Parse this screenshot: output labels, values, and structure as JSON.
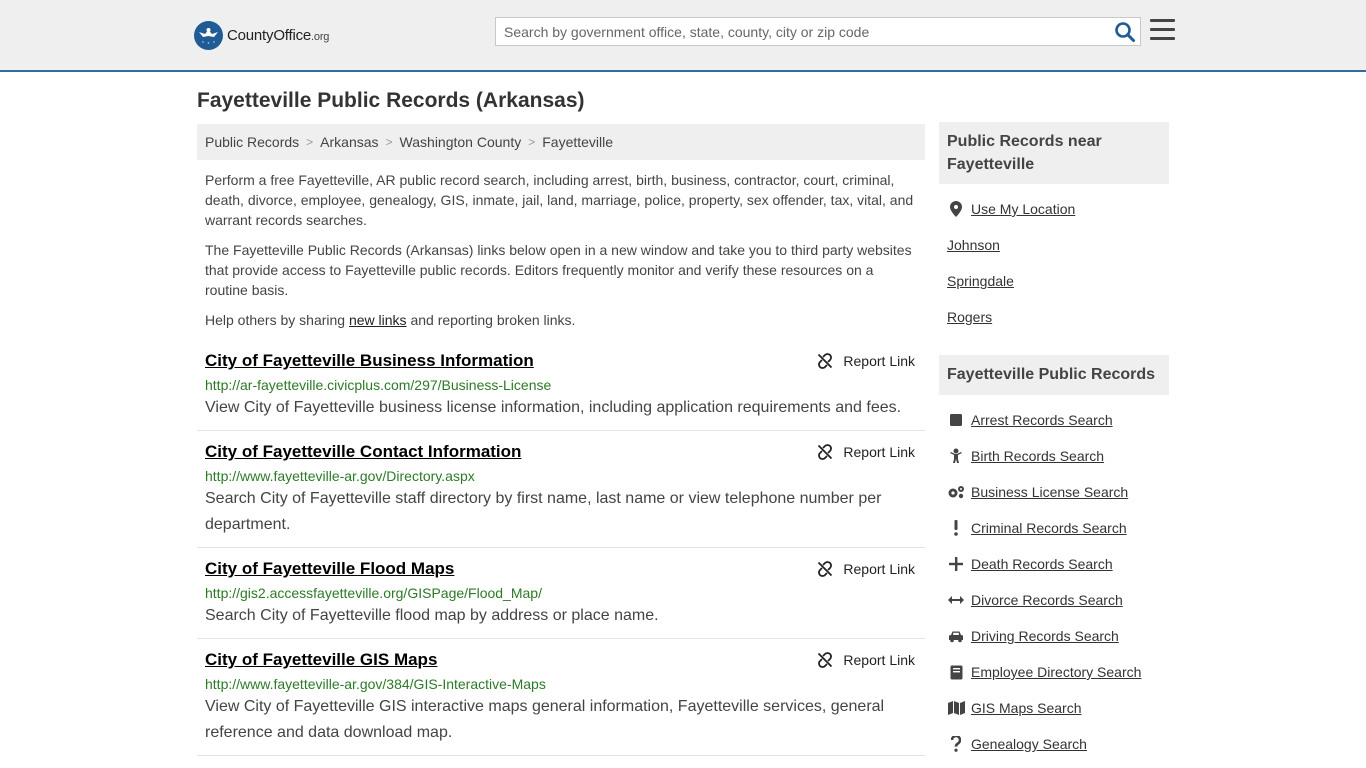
{
  "header": {
    "logo_main": "CountyOffice",
    "logo_suffix": ".org",
    "search_placeholder": "Search by government office, state, county, city or zip code"
  },
  "page_title": "Fayetteville Public Records (Arkansas)",
  "breadcrumb": [
    "Public Records",
    "Arkansas",
    "Washington County",
    "Fayetteville"
  ],
  "intro": {
    "p1": "Perform a free Fayetteville, AR public record search, including arrest, birth, business, contractor, court, criminal, death, divorce, employee, genealogy, GIS, inmate, jail, land, marriage, police, property, sex offender, tax, vital, and warrant records searches.",
    "p2": "The Fayetteville Public Records (Arkansas) links below open in a new window and take you to third party websites that provide access to Fayetteville public records. Editors frequently monitor and verify these resources on a routine basis.",
    "p3_before": "Help others by sharing ",
    "p3_link": "new links",
    "p3_after": " and reporting broken links."
  },
  "report_label": "Report Link",
  "records": [
    {
      "title": "City of Fayetteville Business Information",
      "url": "http://ar-fayetteville.civicplus.com/297/Business-License",
      "desc": "View City of Fayetteville business license information, including application requirements and fees."
    },
    {
      "title": "City of Fayetteville Contact Information",
      "url": "http://www.fayetteville-ar.gov/Directory.aspx",
      "desc": "Search City of Fayetteville staff directory by first name, last name or view telephone number per department."
    },
    {
      "title": "City of Fayetteville Flood Maps",
      "url": "http://gis2.accessfayetteville.org/GISPage/Flood_Map/",
      "desc": "Search City of Fayetteville flood map by address or place name."
    },
    {
      "title": "City of Fayetteville GIS Maps",
      "url": "http://www.fayetteville-ar.gov/384/GIS-Interactive-Maps",
      "desc": "View City of Fayetteville GIS interactive maps general information, Fayetteville services, general reference and data download map."
    }
  ],
  "sidebar": {
    "near_heading": "Public Records near Fayetteville",
    "use_location": "Use My Location",
    "nearby": [
      "Johnson",
      "Springdale",
      "Rogers"
    ],
    "records_heading": "Fayetteville Public Records",
    "record_links": [
      {
        "label": "Arrest Records Search",
        "icon": "square-icon"
      },
      {
        "label": "Birth Records Search",
        "icon": "baby-icon"
      },
      {
        "label": "Business License Search",
        "icon": "gears-icon"
      },
      {
        "label": "Criminal Records Search",
        "icon": "exclamation-icon"
      },
      {
        "label": "Death Records Search",
        "icon": "cross-icon"
      },
      {
        "label": "Divorce Records Search",
        "icon": "arrows-horizontal-icon"
      },
      {
        "label": "Driving Records Search",
        "icon": "car-icon"
      },
      {
        "label": "Employee Directory Search",
        "icon": "book-icon"
      },
      {
        "label": "GIS Maps Search",
        "icon": "map-icon"
      },
      {
        "label": "Genealogy Search",
        "icon": "question-icon"
      }
    ]
  },
  "colors": {
    "header_bg": "#efefef",
    "header_border": "#2e6ca4",
    "url_green": "#2c7a26",
    "logo_blue": "#1f5b94"
  }
}
